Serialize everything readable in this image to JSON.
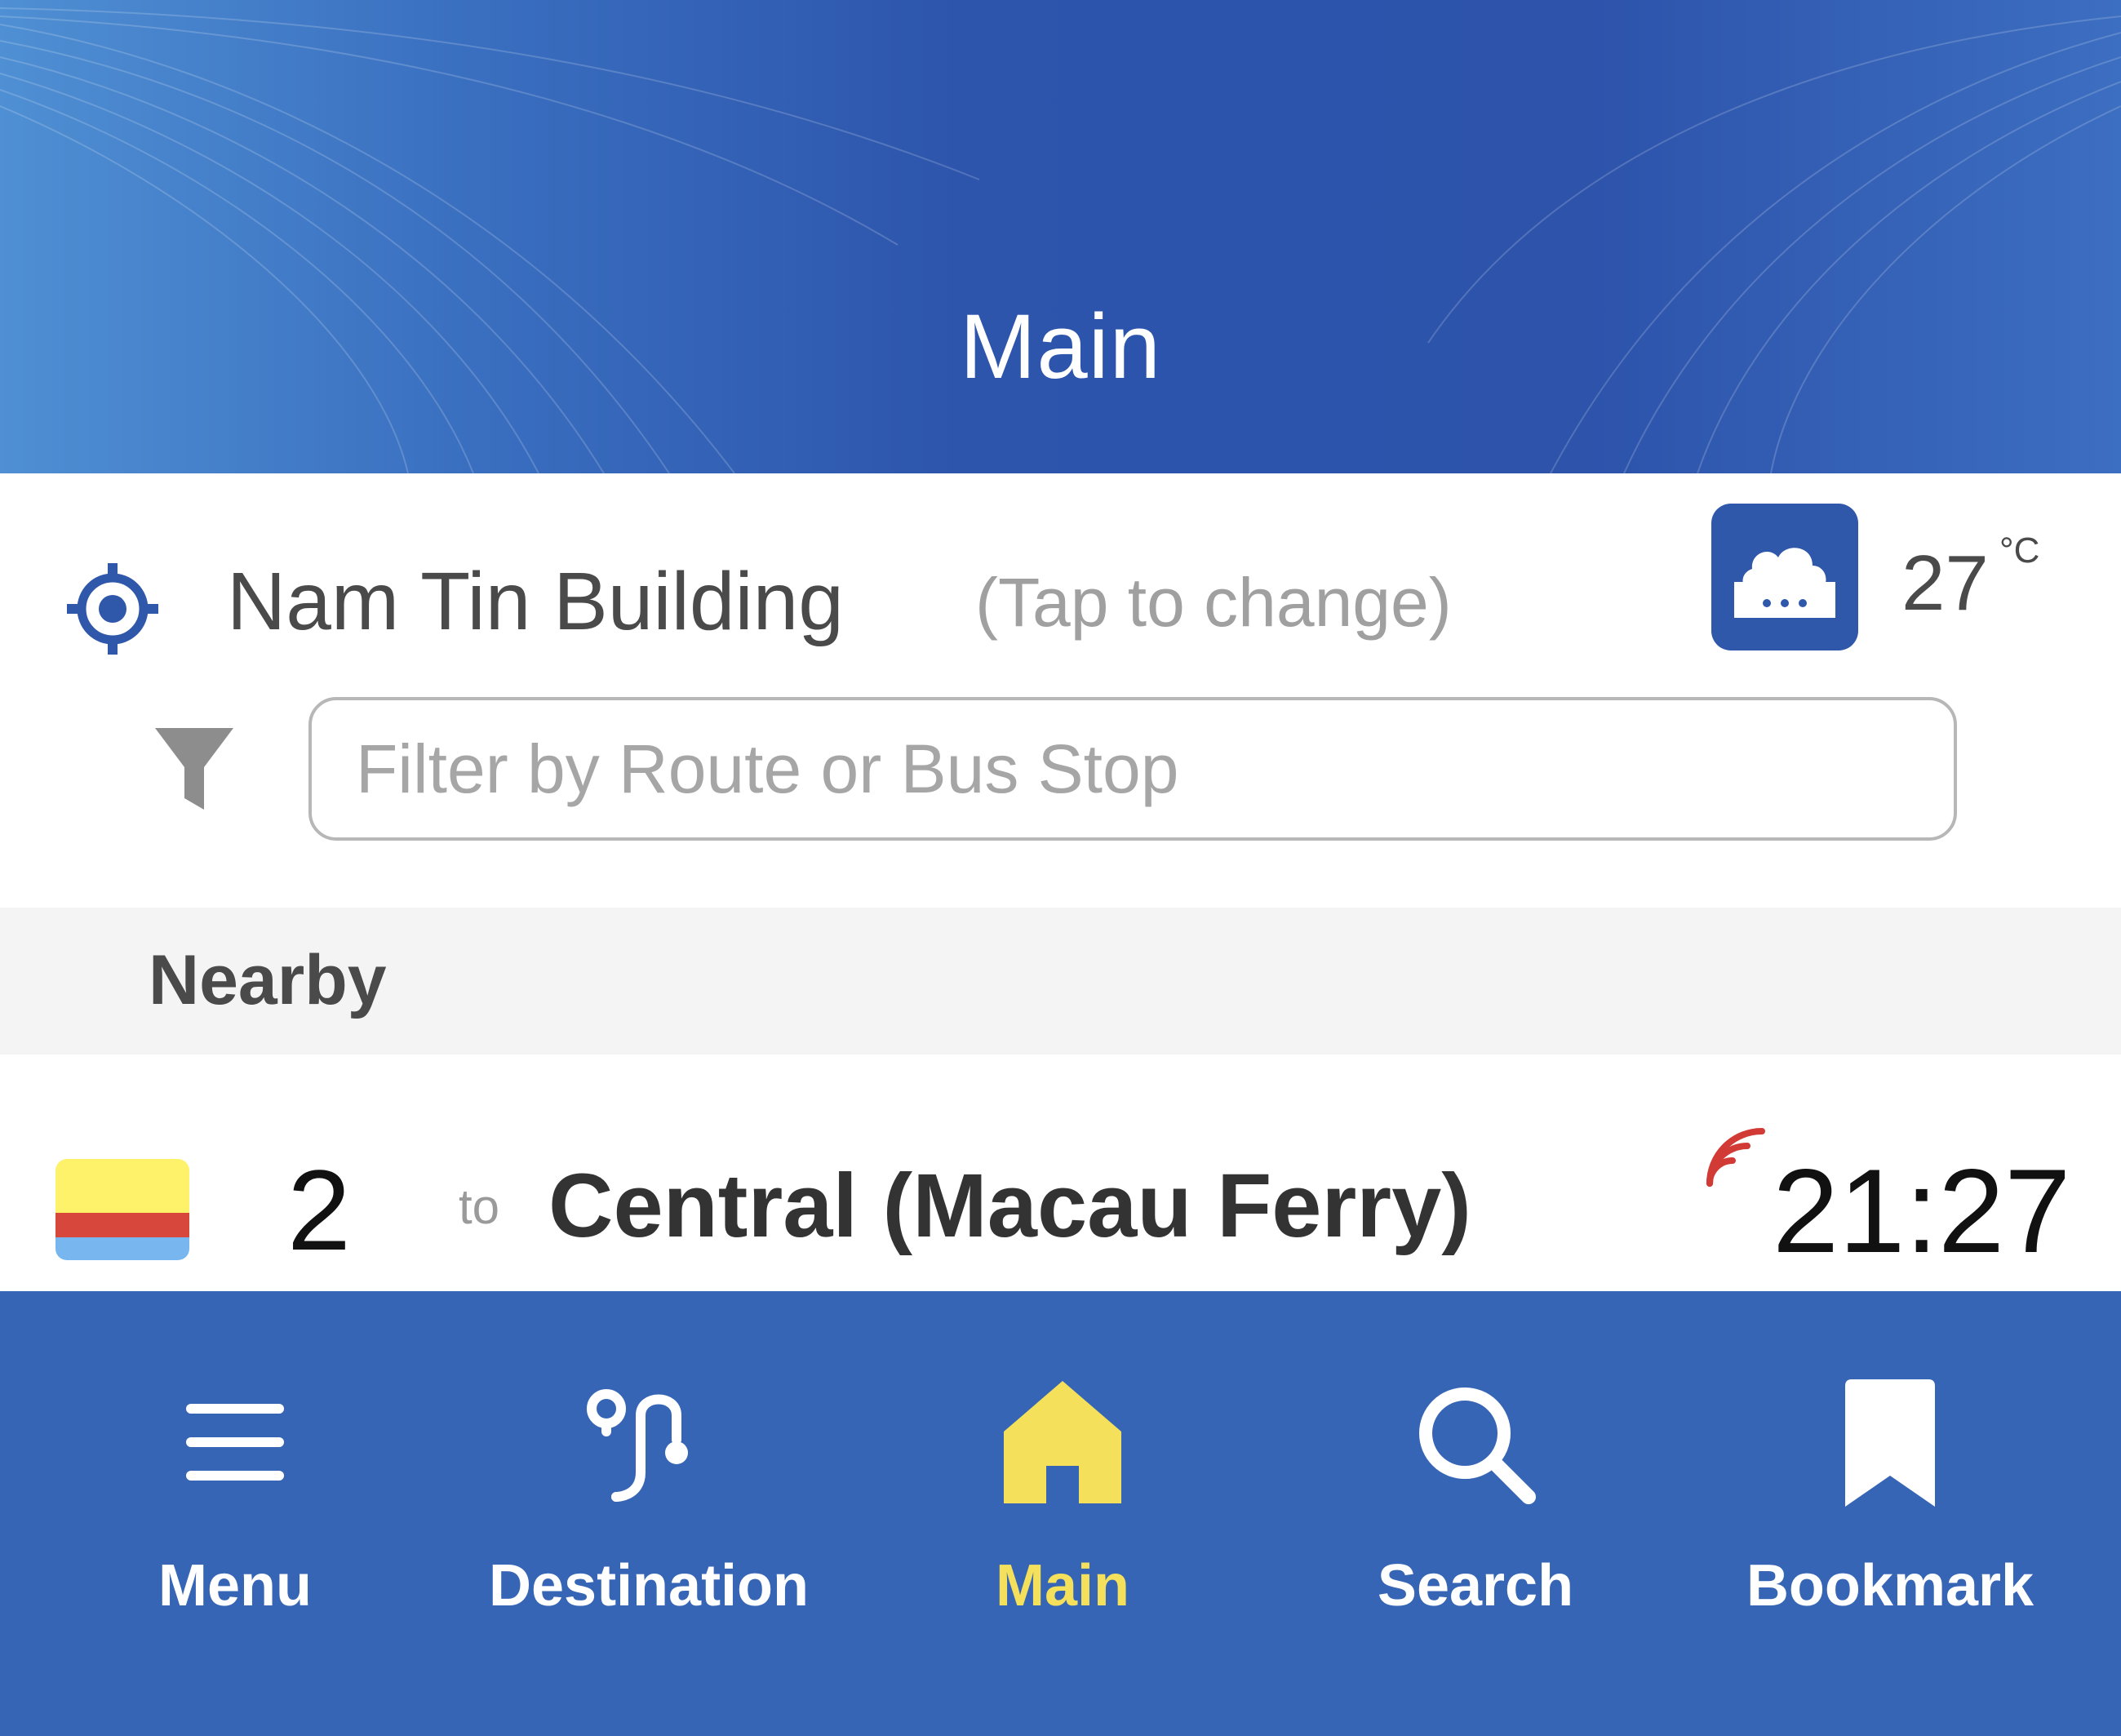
{
  "header": {
    "title": "Main"
  },
  "location": {
    "icon": "locate-target-icon",
    "name": "Nam Tin Building",
    "hint": "(Tap to change)"
  },
  "weather": {
    "icon": "rain-cloud-icon",
    "temperature": "27",
    "unit": "°C"
  },
  "filter": {
    "icon": "filter-icon",
    "placeholder": "Filter by Route or Bus Stop",
    "value": ""
  },
  "section": {
    "title": "Nearby"
  },
  "routes": [
    {
      "number": "2",
      "to_label": "to",
      "destination": "Central (Macau Ferry)",
      "eta": "21:27",
      "live_icon": "live-signal-icon",
      "flag_colors": [
        "#fff26b",
        "#d8473c",
        "#78b6f0"
      ]
    }
  ],
  "bottom_nav": {
    "items": [
      {
        "label": "Menu",
        "icon": "menu-icon"
      },
      {
        "label": "Destination",
        "icon": "route-path-icon"
      },
      {
        "label": "Main",
        "icon": "home-icon",
        "active": true
      },
      {
        "label": "Search",
        "icon": "search-icon"
      },
      {
        "label": "Bookmark",
        "icon": "bookmark-icon"
      }
    ]
  },
  "colors": {
    "header_blue": "#2d53ab",
    "nav_blue": "#3765b6",
    "active_yellow": "#f4e05a",
    "live_red": "#d23a36"
  }
}
